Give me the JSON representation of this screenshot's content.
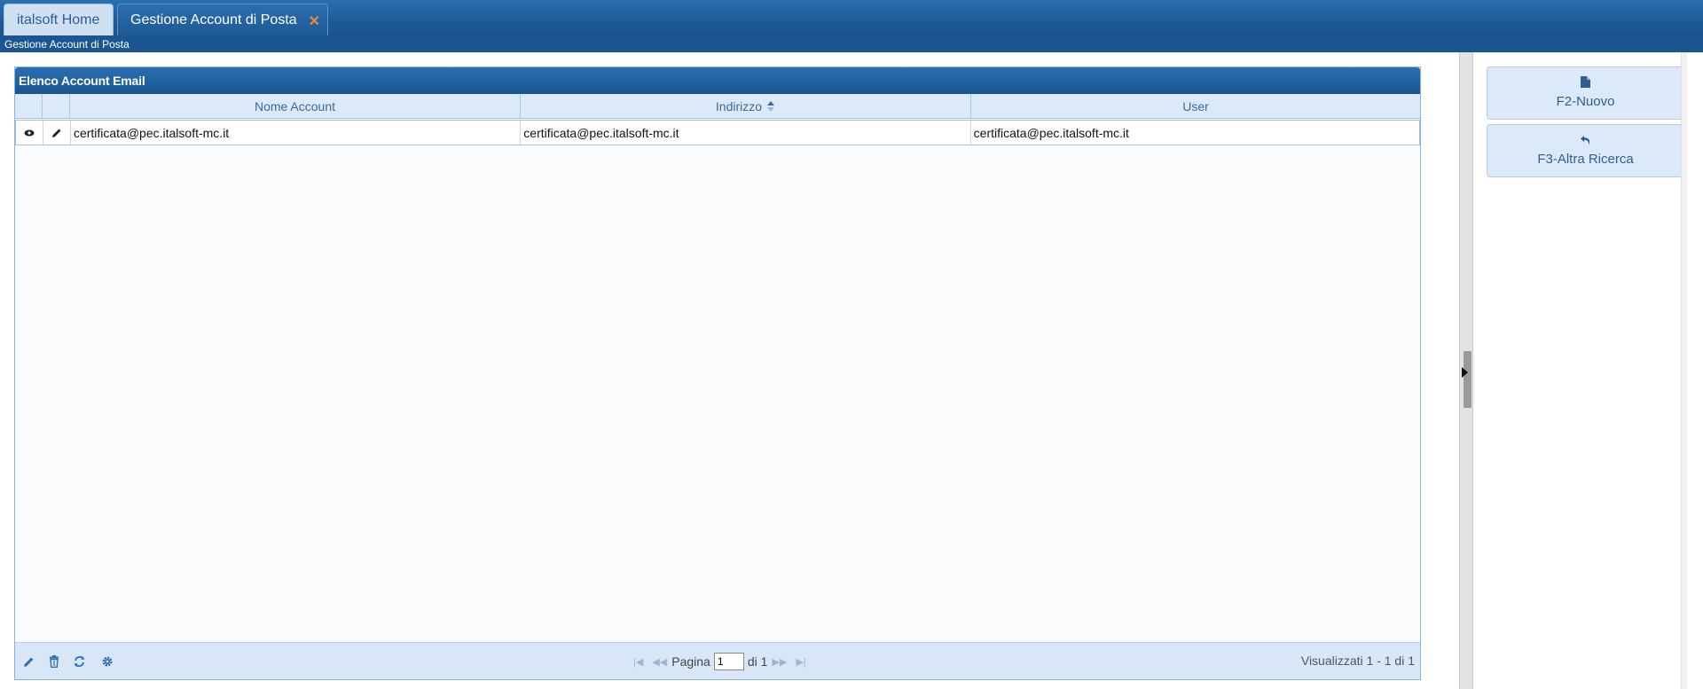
{
  "tabs": [
    {
      "label": "italsoft Home",
      "active": false
    },
    {
      "label": "Gestione Account di Posta",
      "active": true,
      "close": "✕"
    }
  ],
  "breadcrumb": "Gestione Account di Posta",
  "grid": {
    "title": "Elenco Account Email",
    "columns": [
      "Nome Account",
      "Indirizzo",
      "User"
    ],
    "sorted_column": "Indirizzo",
    "rows": [
      {
        "nome": "certificata@pec.italsoft-mc.it",
        "indirizzo": "certificata@pec.italsoft-mc.it",
        "user": "certificata@pec.italsoft-mc.it"
      }
    ]
  },
  "pager": {
    "page_label": "Pagina",
    "page_value": "1",
    "of_label": "di 1",
    "view_info": "Visualizzati 1 - 1 di 1"
  },
  "side_buttons": [
    {
      "label": "F2-Nuovo",
      "icon": "file-icon"
    },
    {
      "label": "F3-Altra Ricerca",
      "icon": "undo-icon"
    }
  ],
  "colors": {
    "accent": "#1b5592",
    "header_bg": "#dbe9f8",
    "close": "#f0873c"
  }
}
